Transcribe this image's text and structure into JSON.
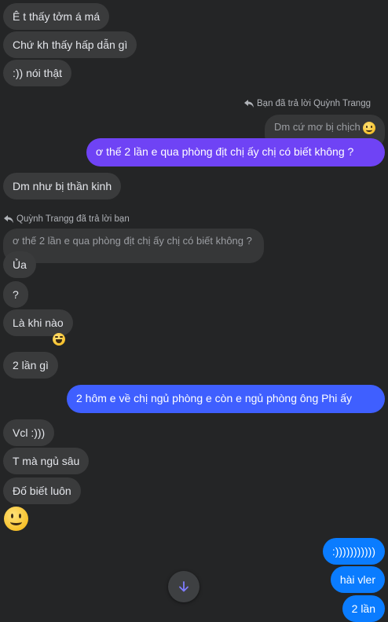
{
  "colors": {
    "background": "#242526",
    "incoming_bubble": "#3a3b3c",
    "outgoing_blue": "#0a7cff",
    "outgoing_purple": "#6f43f5"
  },
  "messages": {
    "m1": "Ê t thấy tởm á má",
    "m2": "Chứ kh thấy hấp dẫn gì",
    "m3": ":)) nói thật",
    "reply_note_1": "Bạn đã trả lời Quỳnh Trangg",
    "quoted_1": "Dm cứ mơ bị chịch",
    "m4": "ơ thế 2 lần e qua phòng địt chị ấy chị có biết không ?",
    "m5": "Dm như bị thần kinh",
    "reply_note_2": "Quỳnh Trangg đã trả lời bạn",
    "quoted_2": "ơ thế 2 lần e qua phòng địt chị ấy chị có biết không ?",
    "m6": "Ủa",
    "m7": "?",
    "m8": "Là khi nào",
    "m9": "2 lần gì",
    "m10": "2 hôm e về chị ngủ phòng e còn e ngủ phòng ông Phi ấy",
    "m11": "Vcl :)))",
    "m12": "T mà ngủ sâu",
    "m13": "Đố biết luôn",
    "m14": ":)))))))))))",
    "m15": "hài vler",
    "m16": "2 lần"
  },
  "icons": {
    "reply_arrow": "reply-arrow-icon",
    "smile_emoji": "smiling-face-emoji",
    "laugh_reaction": "laughing-face-emoji",
    "scroll_down": "arrow-down-icon"
  }
}
